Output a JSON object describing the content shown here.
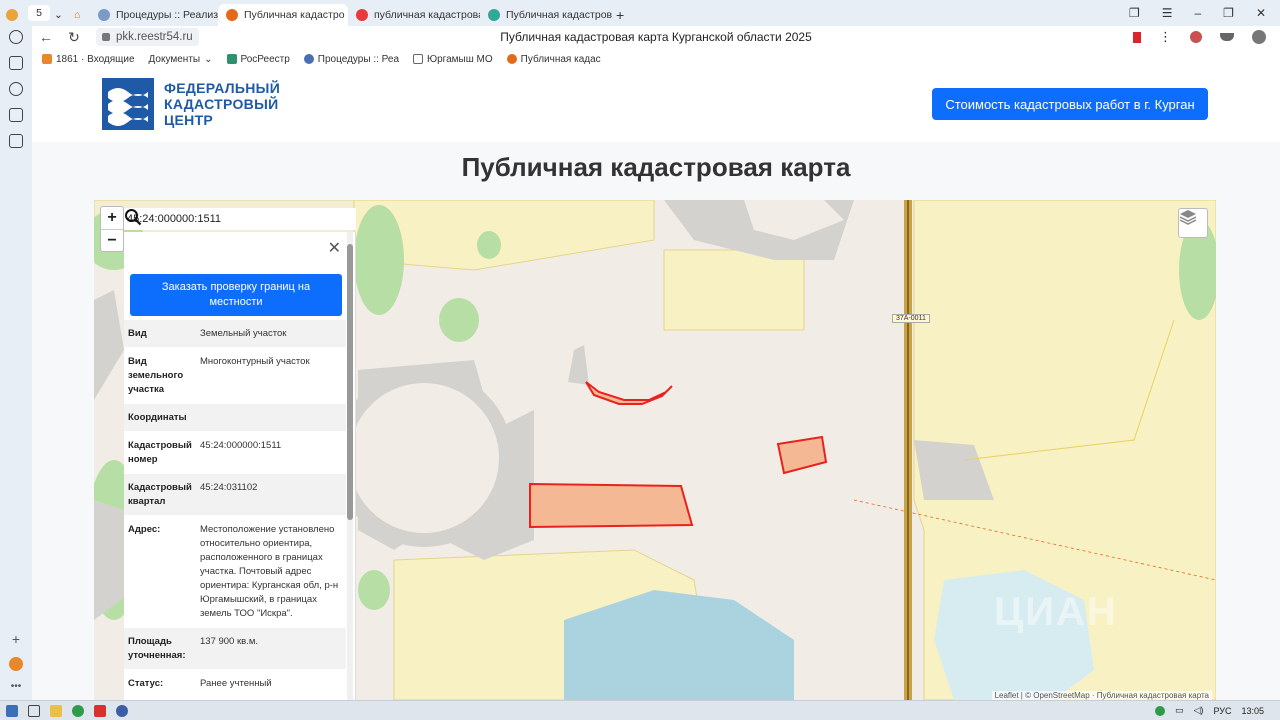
{
  "browser": {
    "tab_counter": "5",
    "tabs": [
      {
        "label": "Процедуры :: Реализация",
        "active": false
      },
      {
        "label": "Публичная кадастро",
        "active": true
      },
      {
        "label": "публичная кадастровая",
        "active": false
      },
      {
        "label": "Публичная кадастров",
        "active": false
      }
    ],
    "url": "pkk.reestr54.ru",
    "page_title": "Публичная кадастровая карта Курганской области 2025",
    "bookmarks": [
      "1861 · Входящие",
      "Документы",
      "РосРеестр",
      "Процедуры :: Реа",
      "Юргамыш МО",
      "Публичная кадас"
    ]
  },
  "site": {
    "logo_lines": [
      "ФЕДЕРАЛЬНЫЙ",
      "КАДАСТРОВЫЙ",
      "ЦЕНТР"
    ],
    "cta_button": "Стоимость кадастровых работ в г. Курган",
    "heading": "Публичная кадастровая карта"
  },
  "map": {
    "search_value": "45:24:000000:1511",
    "road_label": "37А-0011",
    "attribution": "Leaflet | © OpenStreetMap · Публичная кадастровая карта",
    "watermark": "ЦИАН"
  },
  "panel": {
    "order_button": "Заказать проверку границ на местности",
    "rows": [
      {
        "key": "Вид",
        "value": "Земельный участок"
      },
      {
        "key": "Вид земельного участка",
        "value": "Многоконтурный участок"
      },
      {
        "key": "Координаты",
        "value": ""
      },
      {
        "key": "Кадастровый номер",
        "value": "45:24:000000:1511"
      },
      {
        "key": "Кадастровый квартал",
        "value": "45:24:031102"
      },
      {
        "key": "Адрес:",
        "value": "Местоположение установлено относительно ориентира, расположенного в границах участка. Почтовый адрес ориентира: Курганская обл, р-н Юргамышский, в границах земель ТОО \"Искра\"."
      },
      {
        "key": "Площадь уточненная:",
        "value": "137 900 кв.м."
      },
      {
        "key": "Статус:",
        "value": "Ранее учтенный"
      }
    ]
  },
  "taskbar": {
    "lang": "РУС",
    "time": "13:05"
  },
  "colors": {
    "accent": "#0d6efd",
    "brand": "#1f5aa6",
    "parcel_fill": "#f5b895",
    "parcel_stroke": "#e8231d"
  }
}
